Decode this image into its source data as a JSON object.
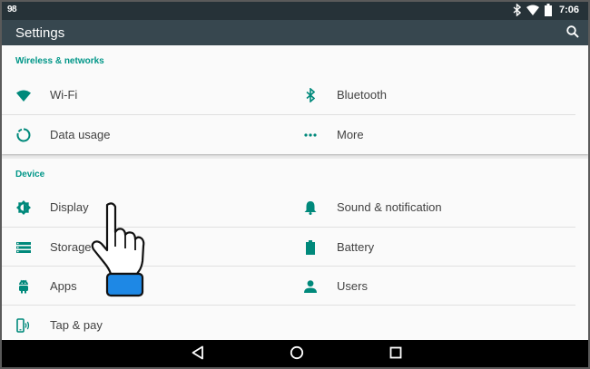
{
  "status_bar": {
    "left_icon": "98",
    "time": "7:06",
    "icons": [
      "bluetooth-icon",
      "wifi-icon",
      "battery-icon"
    ]
  },
  "app_bar": {
    "title": "Settings",
    "search_icon": "search-icon"
  },
  "sections": [
    {
      "title": "Wireless & networks",
      "items": [
        {
          "label": "Wi-Fi",
          "icon": "wifi-icon"
        },
        {
          "label": "Bluetooth",
          "icon": "bluetooth-icon"
        },
        {
          "label": "Data usage",
          "icon": "data-usage-icon"
        },
        {
          "label": "More",
          "icon": "more-icon"
        }
      ]
    },
    {
      "title": "Device",
      "items": [
        {
          "label": "Display",
          "icon": "display-icon"
        },
        {
          "label": "Sound & notification",
          "icon": "bell-icon"
        },
        {
          "label": "Storage",
          "icon": "storage-icon"
        },
        {
          "label": "Battery",
          "icon": "battery-icon"
        },
        {
          "label": "Apps",
          "icon": "android-icon"
        },
        {
          "label": "Users",
          "icon": "user-icon"
        },
        {
          "label": "Tap & pay",
          "icon": "tap-pay-icon"
        }
      ]
    }
  ],
  "nav_bar": {
    "back": "back-icon",
    "home": "home-icon",
    "recents": "recents-icon"
  },
  "colors": {
    "accent": "#009688",
    "status_bar": "#263238",
    "app_bar": "#37474f",
    "icon": "#00897b"
  }
}
